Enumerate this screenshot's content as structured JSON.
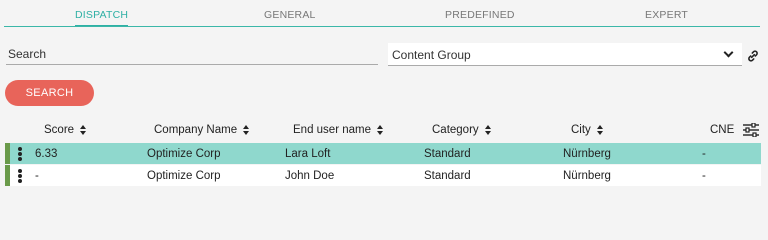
{
  "tabs": [
    {
      "label": "DISPATCH",
      "active": true
    },
    {
      "label": "GENERAL",
      "active": false
    },
    {
      "label": "PREDEFINED",
      "active": false
    },
    {
      "label": "EXPERT",
      "active": false
    }
  ],
  "search": {
    "placeholder": "Search",
    "value": ""
  },
  "content_group": {
    "selected": "Content Group",
    "icon": "chevron-down-icon"
  },
  "link_icon": "link-icon",
  "search_button": {
    "label": "SEARCH"
  },
  "colors": {
    "accent": "#2fb0a5",
    "button": "#e8645a",
    "row_selected": "#8fd8cd",
    "row_marker": "#6a9a4a"
  },
  "table": {
    "columns": [
      "Score",
      "Company Name",
      "End user name",
      "Category",
      "City",
      "CNE"
    ],
    "column_settings_icon": "column-settings-icon",
    "rows": [
      {
        "score": "6.33",
        "company": "Optimize Corp",
        "enduser": "Lara Loft",
        "category": "Standard",
        "city": "Nürnberg",
        "cne": "-",
        "selected": true
      },
      {
        "score": "-",
        "company": "Optimize Corp",
        "enduser": "John Doe",
        "category": "Standard",
        "city": "Nürnberg",
        "cne": "-",
        "selected": false
      }
    ]
  }
}
